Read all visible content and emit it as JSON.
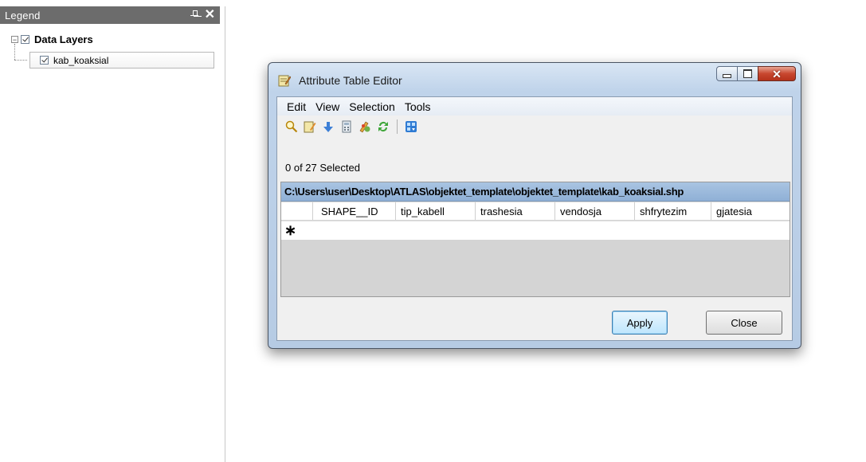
{
  "legend": {
    "title": "Legend",
    "root_label": "Data Layers",
    "layer_label": "kab_koaksial",
    "expander_symbol": "−"
  },
  "dialog": {
    "title": "Attribute Table Editor",
    "menu": [
      "Edit",
      "View",
      "Selection",
      "Tools"
    ],
    "toolbar_icons": [
      "zoom-icon",
      "edit-icon",
      "down-arrow-icon",
      "calculator-icon",
      "field-icon",
      "refresh-icon",
      "export-icon"
    ],
    "selection_status": "0 of 27 Selected",
    "table": {
      "path": "C:\\Users\\user\\Desktop\\ATLAS\\objektet_template\\objektet_template\\kab_koaksial.shp",
      "columns": [
        "SHAPE__ID",
        "tip_kabell",
        "trashesia",
        "vendosja",
        "shfrytezim",
        "gjatesia"
      ],
      "new_row_marker": "∗"
    },
    "buttons": {
      "apply": "Apply",
      "close": "Close"
    }
  },
  "colors": {
    "legend_header": "#6c6c6c",
    "dialog_frame": "#bfd3ea",
    "caption_bar": "#9dbadc",
    "close_button": "#c8472f"
  }
}
